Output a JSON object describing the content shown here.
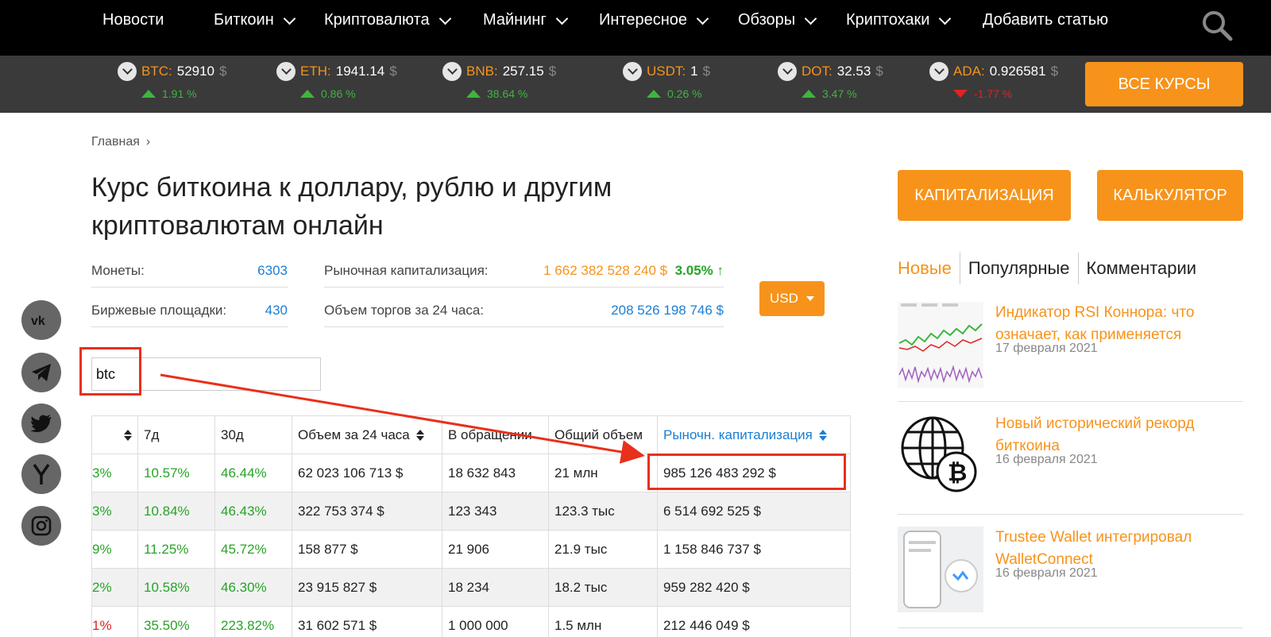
{
  "nav": {
    "items": [
      {
        "label": "Новости",
        "dropdown": false
      },
      {
        "label": "Биткоин",
        "dropdown": true
      },
      {
        "label": "Криптовалюта",
        "dropdown": true
      },
      {
        "label": "Майнинг",
        "dropdown": true
      },
      {
        "label": "Интересное",
        "dropdown": true
      },
      {
        "label": "Обзоры",
        "dropdown": true
      },
      {
        "label": "Криптохаки",
        "dropdown": true
      },
      {
        "label": "Добавить статью",
        "dropdown": false
      }
    ]
  },
  "ticker": {
    "coins": [
      {
        "symbol": "BTC:",
        "price": "52910",
        "currency": "$",
        "change": "1.91 %",
        "direction": "up"
      },
      {
        "symbol": "ETH:",
        "price": "1941.14",
        "currency": "$",
        "change": "0.86 %",
        "direction": "up"
      },
      {
        "symbol": "BNB:",
        "price": "257.15",
        "currency": "$",
        "change": "38.64 %",
        "direction": "up"
      },
      {
        "symbol": "USDT:",
        "price": "1",
        "currency": "$",
        "change": "0.26 %",
        "direction": "up"
      },
      {
        "symbol": "DOT:",
        "price": "32.53",
        "currency": "$",
        "change": "3.47 %",
        "direction": "up"
      },
      {
        "symbol": "ADA:",
        "price": "0.926581",
        "currency": "$",
        "change": "-1.77 %",
        "direction": "down"
      }
    ],
    "all_rates_label": "ВСЕ КУРСЫ"
  },
  "breadcrumb": {
    "home": "Главная",
    "sep": "›"
  },
  "page_title": "Курс биткоина к доллару, рублю и другим криптовалютам онлайн",
  "stats": {
    "coins_label": "Монеты:",
    "coins_value": "6303",
    "exchanges_label": "Биржевые площадки:",
    "exchanges_value": "430",
    "cap_label": "Рыночная капитализация:",
    "cap_value": "1 662 382 528 240 $",
    "cap_change": "3.05%",
    "cap_arrow": "↑",
    "volume_label": "Объем торгов за 24 часа:",
    "volume_value": "208 526 198 746 $"
  },
  "currency_select": {
    "value": "USD"
  },
  "search": {
    "value": "btc"
  },
  "table": {
    "headers": [
      "",
      "7д",
      "30д",
      "Объем за 24 часа",
      "В обращении",
      "Общий объем",
      "Рыночн. капитализация"
    ],
    "rows": [
      {
        "c0": "3%",
        "c0_color": "green",
        "c1": "10.57%",
        "c2": "46.44%",
        "c3": "62 023 106 713 $",
        "c4": "18 632 843",
        "c5": "21 млн",
        "c6": "985 126 483 292 $"
      },
      {
        "c0": "3%",
        "c0_color": "green",
        "c1": "10.84%",
        "c2": "46.43%",
        "c3": "322 753 374 $",
        "c4": "123 343",
        "c5": "123.3 тыс",
        "c6": "6 514 692 525 $"
      },
      {
        "c0": "9%",
        "c0_color": "green",
        "c1": "11.25%",
        "c2": "45.72%",
        "c3": "158 877 $",
        "c4": "21 906",
        "c5": "21.9 тыс",
        "c6": "1 158 846 737 $"
      },
      {
        "c0": "2%",
        "c0_color": "green",
        "c1": "10.58%",
        "c2": "46.30%",
        "c3": "23 915 827 $",
        "c4": "18 234",
        "c5": "18.2 тыс",
        "c6": "959 282 420 $"
      },
      {
        "c0": "1%",
        "c0_color": "red",
        "c1": "35.50%",
        "c2": "223.82%",
        "c3": "31 602 571 $",
        "c4": "1 000 000",
        "c5": "1.5 млн",
        "c6": "212 446 049 $"
      }
    ]
  },
  "social": [
    "vk-icon",
    "telegram-icon",
    "twitter-icon",
    "yandex-icon",
    "instagram-icon"
  ],
  "sidebar": {
    "cap_button": "КАПИТАЛИЗАЦИЯ",
    "calc_button": "КАЛЬКУЛЯТОР",
    "tabs": [
      "Новые",
      "Популярные",
      "Комментарии"
    ],
    "news": [
      {
        "title": "Индикатор RSI Коннора: что означает, как применяется",
        "date": "17 февраля 2021"
      },
      {
        "title": "Новый исторический рекорд биткоина",
        "date": "16 февраля 2021"
      },
      {
        "title": "Trustee Wallet интегрировал WalletConnect",
        "date": "16 февраля 2021"
      }
    ]
  },
  "colors": {
    "accent": "#f7931a",
    "up": "#27a327",
    "down": "#e02424",
    "link": "#1a7fd4",
    "annotation": "#e8301c"
  }
}
